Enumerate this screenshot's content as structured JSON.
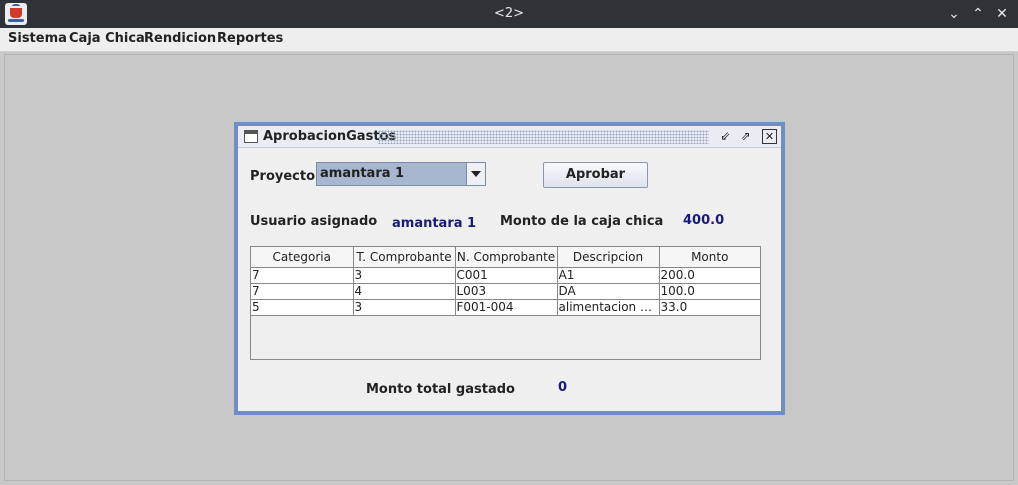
{
  "window": {
    "title": "<2>"
  },
  "menu": [
    "Sistema",
    "Caja Chica",
    "Rendicion",
    "Reportes"
  ],
  "frame": {
    "title": "AprobacionGastos",
    "proyecto_label": "Proyecto",
    "proyecto_value": "amantara 1",
    "aprobar_label": "Aprobar",
    "usuario_label": "Usuario asignado",
    "usuario_value": "amantara 1",
    "monto_caja_label": "Monto de la caja chica",
    "monto_caja_value": "400.0",
    "monto_total_label": "Monto total gastado",
    "monto_total_value": "0"
  },
  "table": {
    "headers": [
      "Categoria",
      "T. Comprobante",
      "N. Comprobante",
      "Descripcion",
      "Monto"
    ],
    "rows": [
      [
        "7",
        "3",
        "C001",
        "A1",
        "200.0"
      ],
      [
        "7",
        "4",
        "L003",
        "DA",
        "100.0"
      ],
      [
        "5",
        "3",
        "F001-004",
        "alimentacion di...",
        "33.0"
      ]
    ]
  }
}
